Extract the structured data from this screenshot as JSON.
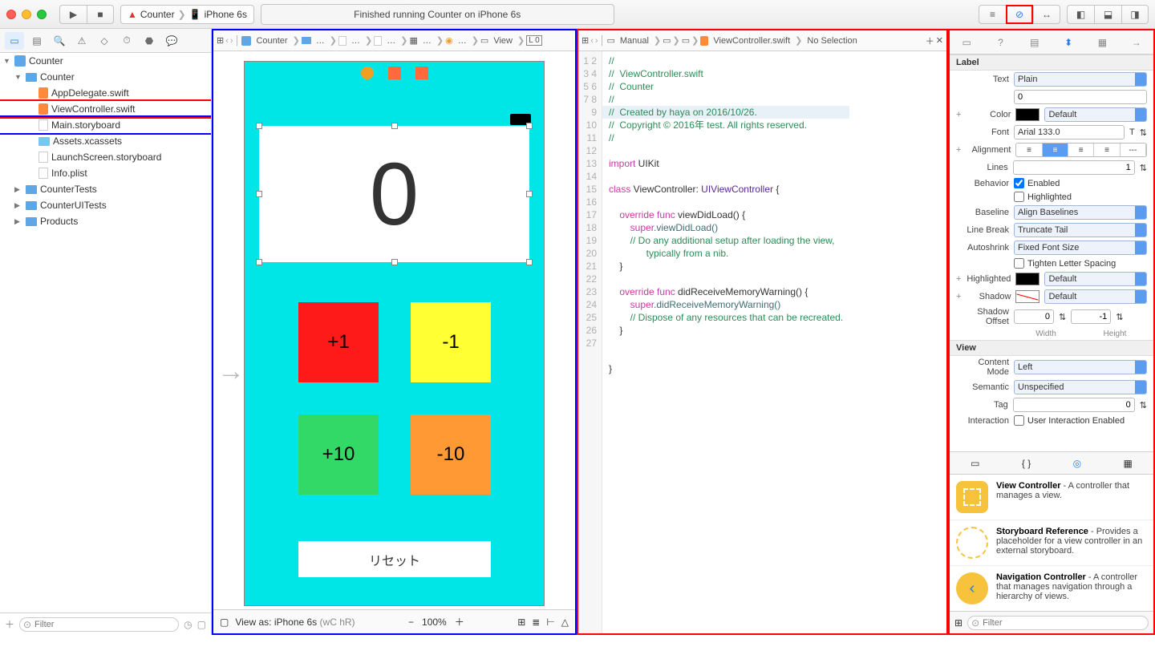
{
  "titlebar": {
    "scheme_app": "Counter",
    "scheme_device": "iPhone 6s",
    "status": "Finished running Counter on iPhone 6s"
  },
  "navigator": {
    "project": "Counter",
    "folders": [
      {
        "name": "Counter",
        "expanded": true,
        "children": [
          {
            "name": "AppDelegate.swift",
            "type": "swift"
          },
          {
            "name": "ViewController.swift",
            "type": "swift",
            "selected_red": true
          },
          {
            "name": "Main.storyboard",
            "type": "storyboard",
            "selected_blue": true
          },
          {
            "name": "Assets.xcassets",
            "type": "assets"
          },
          {
            "name": "LaunchScreen.storyboard",
            "type": "storyboard"
          },
          {
            "name": "Info.plist",
            "type": "plist"
          }
        ]
      },
      {
        "name": "CounterTests"
      },
      {
        "name": "CounterUITests"
      },
      {
        "name": "Products"
      }
    ],
    "filter_placeholder": "Filter"
  },
  "ib": {
    "jump_segments": [
      "Counter",
      "…",
      "…",
      "…",
      "…",
      "…",
      "View",
      "L  0"
    ],
    "counter_value": "0",
    "buttons": {
      "p1": "+1",
      "m1": "-1",
      "p10": "+10",
      "m10": "-10",
      "reset": "リセット"
    },
    "view_as": "View as: iPhone 6s",
    "size_class": "(wC hR)",
    "zoom": "100%"
  },
  "assistant": {
    "mode": "Manual",
    "file": "ViewController.swift",
    "selection": "No Selection",
    "lines": [
      "1",
      "2",
      "3",
      "4",
      "5",
      "6",
      "7",
      "8",
      "9",
      "10",
      "11",
      "12",
      "13",
      "14",
      "15",
      "16",
      "17",
      "18",
      "19",
      "20",
      "21",
      "22",
      "23",
      "24",
      "25",
      "26",
      "27"
    ],
    "src": {
      "l1": "//",
      "l2": "//  ViewController.swift",
      "l3": "//  Counter",
      "l4": "//",
      "l5": "//  Created by haya on 2016/10/26.",
      "l6": "//  Copyright © 2016年 test. All rights reserved.",
      "l7": "//",
      "l9a": "import",
      "l9b": " UIKit",
      "l11a": "class",
      "l11b": " ViewController: ",
      "l11c": "UIViewController",
      "l11d": " {",
      "l13a": "    override func",
      "l13b": " viewDidLoad() {",
      "l14a": "        super",
      "l14b": ".viewDidLoad()",
      "l15": "        // Do any additional setup after loading the view,",
      "l15b": "              typically from a nib.",
      "l16": "    }",
      "l18a": "    override func",
      "l18b": " didReceiveMemoryWarning() {",
      "l19a": "        super",
      "l19b": ".didReceiveMemoryWarning()",
      "l20": "        // Dispose of any resources that can be recreated.",
      "l21": "    }",
      "l24": "}"
    }
  },
  "inspector": {
    "section_label": "Label",
    "text_label": "Text",
    "text_mode": "Plain",
    "text_value": "0",
    "color_label": "Color",
    "color_value": "Default",
    "font_label": "Font",
    "font_value": "Arial 133.0",
    "alignment_label": "Alignment",
    "lines_label": "Lines",
    "lines_value": "1",
    "behavior_label": "Behavior",
    "enabled": "Enabled",
    "highlighted_chk": "Highlighted",
    "baseline_label": "Baseline",
    "baseline_value": "Align Baselines",
    "linebreak_label": "Line Break",
    "linebreak_value": "Truncate Tail",
    "autoshrink_label": "Autoshrink",
    "autoshrink_value": "Fixed Font Size",
    "tighten": "Tighten Letter Spacing",
    "highlighted_label": "Highlighted",
    "highlighted_value": "Default",
    "shadow_label": "Shadow",
    "shadow_value": "Default",
    "shadowoff_label": "Shadow Offset",
    "shadowoff_w": "0",
    "shadowoff_h": "-1",
    "width_label": "Width",
    "height_label": "Height",
    "section_view": "View",
    "contentmode_label": "Content Mode",
    "contentmode_value": "Left",
    "semantic_label": "Semantic",
    "semantic_value": "Unspecified",
    "tag_label": "Tag",
    "tag_value": "0",
    "interaction_label": "Interaction",
    "interaction_chk": "User Interaction Enabled",
    "library": {
      "items": [
        {
          "title": "View Controller",
          "desc": " - A controller that manages a view.",
          "color": "#f7c23c"
        },
        {
          "title": "Storyboard Reference",
          "desc": " - Provides a placeholder for a view controller in an external storyboard.",
          "color": "#f7c23c",
          "dashed": true
        },
        {
          "title": "Navigation Controller",
          "desc": " - A controller that manages navigation through a hierarchy of views.",
          "color": "#f7c23c",
          "icon_bg": "#2a7de1"
        }
      ],
      "filter_placeholder": "Filter"
    }
  }
}
